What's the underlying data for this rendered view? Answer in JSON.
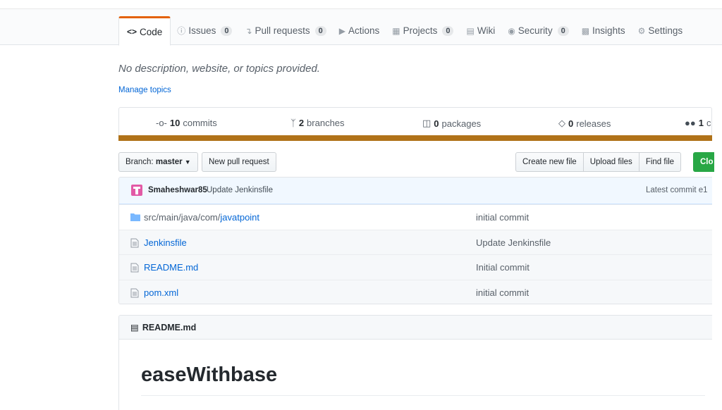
{
  "tabs": [
    {
      "label": "Code",
      "icon": "code-icon",
      "active": true
    },
    {
      "label": "Issues",
      "count": "0",
      "icon": "issue-icon"
    },
    {
      "label": "Pull requests",
      "count": "0",
      "icon": "pull-request-icon"
    },
    {
      "label": "Actions",
      "icon": "play-icon"
    },
    {
      "label": "Projects",
      "count": "0",
      "icon": "project-icon"
    },
    {
      "label": "Wiki",
      "icon": "book-icon"
    },
    {
      "label": "Security",
      "count": "0",
      "icon": "shield-icon"
    },
    {
      "label": "Insights",
      "icon": "graph-icon"
    },
    {
      "label": "Settings",
      "icon": "gear-icon"
    }
  ],
  "repo": {
    "description": "No description, website, or topics provided.",
    "manage_topics": "Manage topics"
  },
  "stats": {
    "commits_count": "10",
    "commits_label": "commits",
    "branches_count": "2",
    "branches_label": "branches",
    "packages_count": "0",
    "packages_label": "packages",
    "releases_count": "0",
    "releases_label": "releases",
    "contributors_count": "1",
    "contributors_label": "co"
  },
  "language_color": "#b07219",
  "toolbar": {
    "branch_prefix": "Branch:",
    "branch_name": "master",
    "new_pull_request": "New pull request",
    "create_new_file": "Create new file",
    "upload_files": "Upload files",
    "find_file": "Find file",
    "clone": "Clo"
  },
  "commit": {
    "author": "Smaheshwar85",
    "message": "Update Jenkinsfile",
    "latest": "Latest commit e1"
  },
  "files": [
    {
      "type": "folder",
      "path_prefix": "src/main/java/com/",
      "name": "javatpoint",
      "message": "initial commit"
    },
    {
      "type": "file",
      "path_prefix": "",
      "name": "Jenkinsfile",
      "message": "Update Jenkinsfile"
    },
    {
      "type": "file",
      "path_prefix": "",
      "name": "README.md",
      "message": "Initial commit"
    },
    {
      "type": "file",
      "path_prefix": "",
      "name": "pom.xml",
      "message": "initial commit"
    }
  ],
  "readme": {
    "header": "README.md",
    "title": "easeWithbase"
  }
}
